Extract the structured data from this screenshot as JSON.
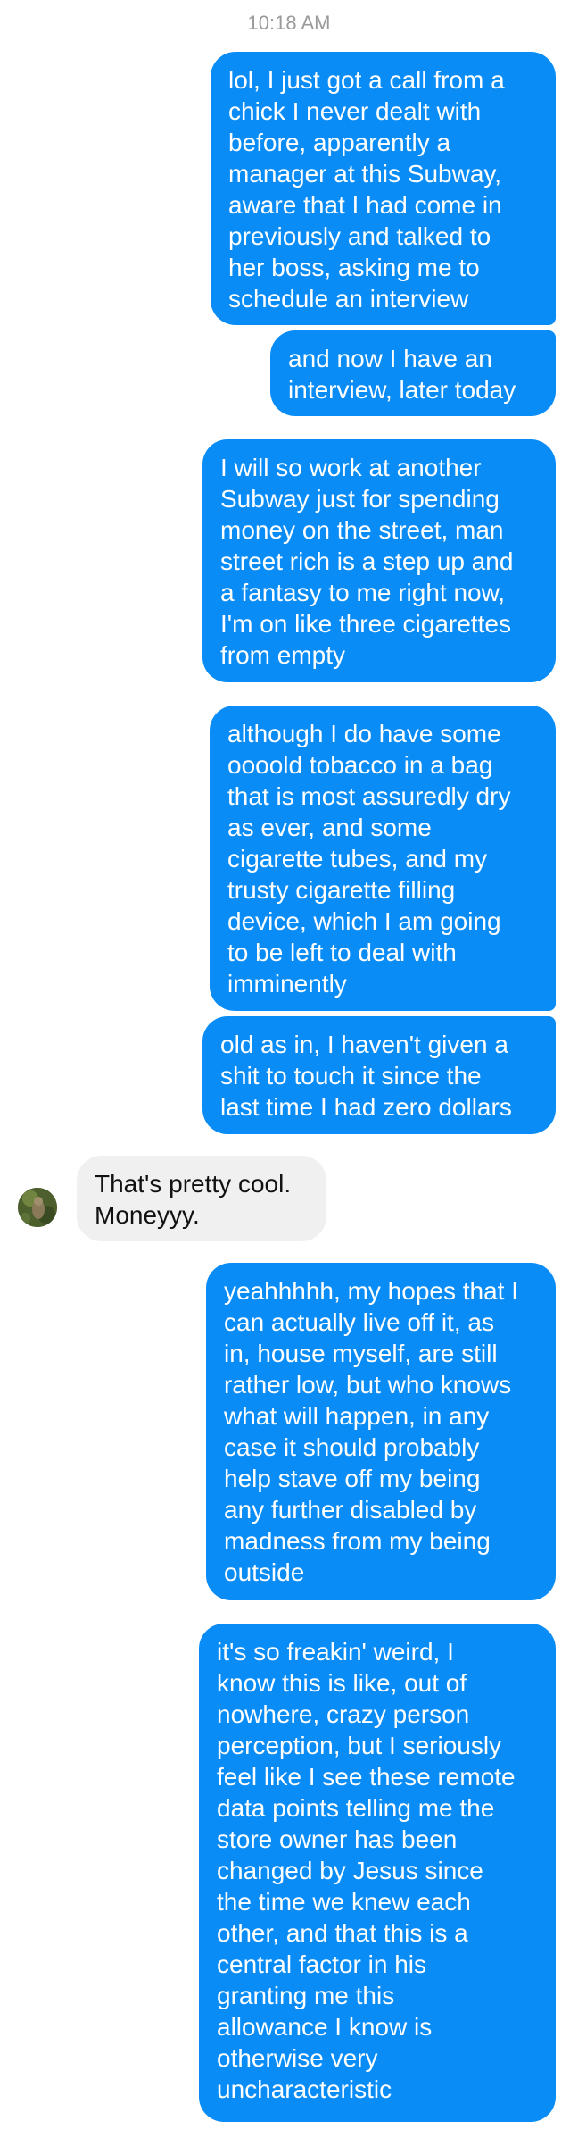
{
  "thread": {
    "timestamp": "10:18 AM",
    "messages": [
      {
        "side": "out",
        "text": "lol, I just got a call from a\nchick I never dealt with\nbefore, apparently a\nmanager at this Subway,\naware that I had come in\npreviously and talked to\nher boss, asking me to\nschedule an interview"
      },
      {
        "side": "out",
        "text": "and now I have an\ninterview, later today"
      },
      {
        "side": "out",
        "text": "I will so work at another\nSubway just for spending\nmoney on the street, man\nstreet rich is a step up and\na fantasy to me right now,\nI'm on like three cigarettes\nfrom empty"
      },
      {
        "side": "out",
        "text": "although I do have some\noooold tobacco in a bag\nthat is most assuredly dry\nas ever, and some\ncigarette tubes, and my\ntrusty cigarette filling\ndevice, which I am going\nto be left to deal with\nimminently"
      },
      {
        "side": "out",
        "text": "old as in, I haven't given a\nshit to touch it since the\nlast time I had zero dollars"
      },
      {
        "side": "in",
        "text": "That's pretty cool.\nMoneyyy."
      },
      {
        "side": "out",
        "text": "yeahhhhh, my hopes that I\ncan actually live off it, as\nin, house myself, are still\nrather low, but who knows\nwhat will happen, in any\ncase it should probably\nhelp stave off my being\nany further disabled by\nmadness from my being\noutside"
      },
      {
        "side": "out",
        "text": "it's so freakin' weird, I\nknow this is like, out of\nnowhere, crazy person\nperception, but I seriously\nfeel like I see these remote\ndata points telling me the\nstore owner has been\nchanged by Jesus since\nthe time we knew each\nother, and that this is a\ncentral factor in his\ngranting me this\nallowance I know is\notherwise very\nuncharacteristic"
      }
    ]
  },
  "colors": {
    "outgoing_bubble": "#0a8cf6",
    "incoming_bubble": "#f0f0f0",
    "timestamp_text": "#9a9a9a"
  },
  "icons": {
    "contact_avatar": "avatar"
  }
}
